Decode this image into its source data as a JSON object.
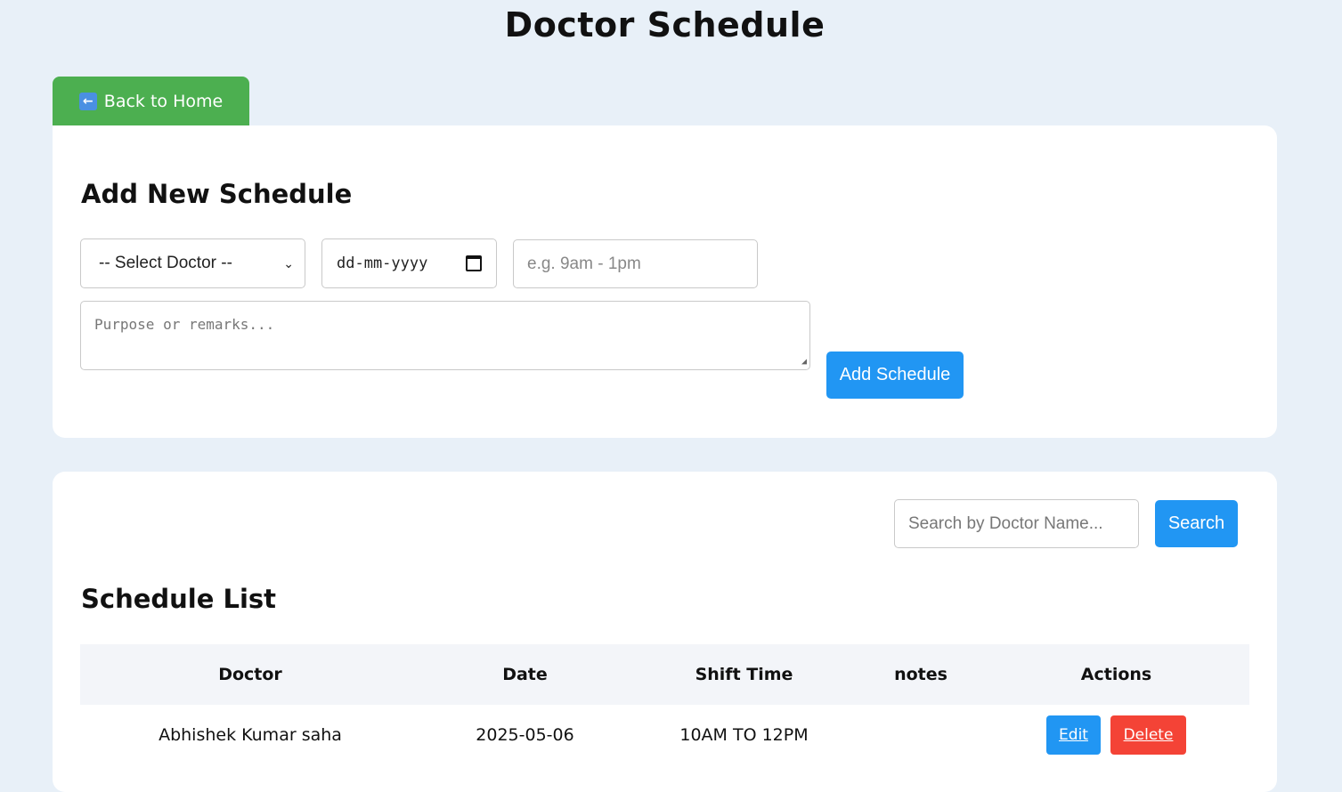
{
  "header": {
    "title": "Doctor Schedule"
  },
  "nav": {
    "back_label": "Back to Home",
    "back_icon": "left-arrow-icon"
  },
  "add_form": {
    "title": "Add New Schedule",
    "doctor_select_value": "-- Select Doctor --",
    "date_placeholder": "dd-mm-yyyy",
    "shift_placeholder": "e.g. 9am - 1pm",
    "remarks_placeholder": "Purpose or remarks...",
    "submit_label": "Add Schedule"
  },
  "search": {
    "placeholder": "Search by Doctor Name...",
    "button_label": "Search"
  },
  "list": {
    "title": "Schedule List",
    "columns": [
      "Doctor",
      "Date",
      "Shift Time",
      "notes",
      "Actions"
    ],
    "rows": [
      {
        "doctor": "Abhishek Kumar saha",
        "date": "2025-05-06",
        "shift": "10AM TO 12PM",
        "notes": "",
        "edit_label": "Edit",
        "delete_label": "Delete"
      }
    ]
  },
  "colors": {
    "background": "#e8f0f8",
    "back_button": "#4caf50",
    "primary": "#2196f3",
    "danger": "#f44336"
  }
}
